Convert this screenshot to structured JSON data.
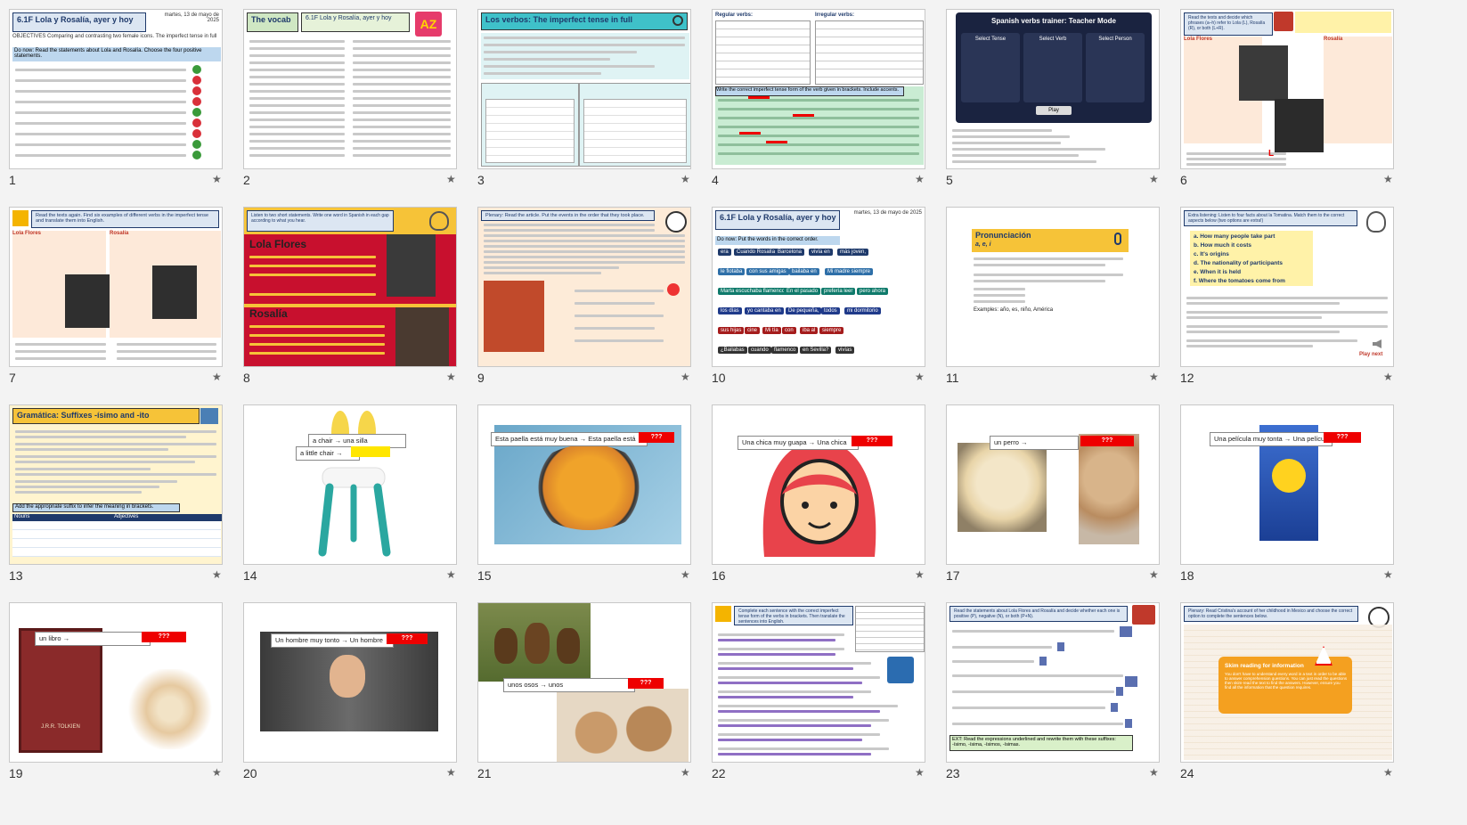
{
  "slides": [
    {
      "number": "1",
      "header": "6.1F Lola y Rosalía, ayer y hoy",
      "date": "martes, 13 de mayo de 2025",
      "objectives": "OBJECTIVES Comparing and contrasting two female icons. The imperfect tense in full",
      "instruction": "Do now: Read the statements about Lola and Rosalía. Choose the four positive statements."
    },
    {
      "number": "2",
      "header": "The vocab",
      "subheader": "6.1F Lola y Rosalía, ayer y hoy",
      "badge": "AZ"
    },
    {
      "number": "3",
      "header": "Los verbos: The imperfect tense in full"
    },
    {
      "number": "4",
      "header": "Regular verbs:",
      "subheader": "Irregular verbs:",
      "instruction": "Write the correct imperfect tense form of the verb given in brackets. Include accents."
    },
    {
      "number": "5",
      "header": "Spanish verbs trainer: Teacher Mode",
      "cols": [
        "Select Tense",
        "Select Verb",
        "Select Person"
      ],
      "play": "Play"
    },
    {
      "number": "6",
      "header": "Read the texts and decide which phrases (a–h) refer to Lola (L), Rosalía (R), or both (L+R).",
      "names": [
        "Lola Flores",
        "Rosalía"
      ]
    },
    {
      "number": "7",
      "header": "Read the texts again. Find six examples of different verbs in the imperfect tense and translate them into English.",
      "names": [
        "Lola Flores",
        "Rosalía"
      ]
    },
    {
      "number": "8",
      "header": "Listen to two short statements. Write one word in Spanish in each gap according to what you hear.",
      "names": [
        "Lola Flores",
        "Rosalía"
      ]
    },
    {
      "number": "9",
      "header": "Plenary: Read the article. Put the events in the order that they took place."
    },
    {
      "number": "10",
      "header": "6.1F Lola y Rosalía, ayer y hoy",
      "date": "martes, 13 de mayo de 2025",
      "instruction": "Do now: Put the words in the correct order.",
      "words": [
        "era",
        "Cuando Rosalía",
        "Barcelona",
        "vivía en",
        "más joven,",
        "le flotaba",
        "con sus amigas",
        "bailaba en",
        "Mi madre siempre",
        "Marta escuchaba flamenco",
        "En el pasado",
        "prefería leer",
        "pero ahora",
        "los días",
        "yo cantaba en",
        "De pequeña,",
        "todos",
        "mi dormitorio",
        "sus hijas",
        "cine",
        "Mi tía",
        "con",
        "iba al",
        "siempre",
        "¿Bailabas",
        "cuando",
        "flamenco",
        "en Sevilla?",
        "vivías"
      ]
    },
    {
      "number": "11",
      "header": "Pronunciación",
      "subheader": "a, e, i",
      "examples": "Examples: año, es, niño, América"
    },
    {
      "number": "12",
      "header": "Extra listening: Listen to four facts about la Tomatina. Match them to the correct aspects below (two options are extra!)",
      "options": [
        "a. How many people take part",
        "b. How much it costs",
        "c. It's origins",
        "d. The nationality of participants",
        "e. When it is held",
        "f. Where the tomatoes come from"
      ],
      "play": "Play next"
    },
    {
      "number": "13",
      "header": "Gramática: Suffixes -ísimo and -ito",
      "task": "Add the appropriate suffix to infer the meaning in brackets.",
      "table_headers": [
        "Nouns",
        "Adjectives"
      ]
    },
    {
      "number": "14",
      "phrase1": "a chair → una silla",
      "phrase2": "a little chair →",
      "answer": "???"
    },
    {
      "number": "15",
      "phrase1": "Esta paella está muy buena → Esta paella está",
      "answer": "???"
    },
    {
      "number": "16",
      "phrase1": "Una chica muy guapa → Una chica",
      "answer": "???"
    },
    {
      "number": "17",
      "phrase1": "un perro →",
      "answer": "???"
    },
    {
      "number": "18",
      "phrase1": "Una película muy tonta → Una película",
      "answer": "???"
    },
    {
      "number": "19",
      "phrase1": "un libro →",
      "answer": "???",
      "book": "J.R.R. TOLKIEN"
    },
    {
      "number": "20",
      "phrase1": "Un hombre muy tonto → Un hombre",
      "answer": "???"
    },
    {
      "number": "21",
      "phrase1": "unos osos → unos",
      "answer": "???"
    },
    {
      "number": "22",
      "header": "Complete each sentence with the correct imperfect tense form of the verbs in brackets. Then translate the sentences into English."
    },
    {
      "number": "23",
      "header": "Read the statements about Lola Flores and Rosalía and decide whether each one is positive (P), negative (N), or both (P+N).",
      "ext": "EXT: Read the expressions underlined and rewrite them with these suffixes: -ísimo, -ísima, -ísimos, -ísimas."
    },
    {
      "number": "24",
      "header": "Plenary: Read Cristina's account of her childhood in Mexico and choose the correct option to complete the sentences below.",
      "callout_title": "Skim reading for information",
      "callout_text": "You don't have to understand every word in a text in order to be able to answer comprehension questions. You can just read the questions then skim-read the text to find the answers. However, ensure you find all the information that the question requires."
    }
  ],
  "star": "★"
}
